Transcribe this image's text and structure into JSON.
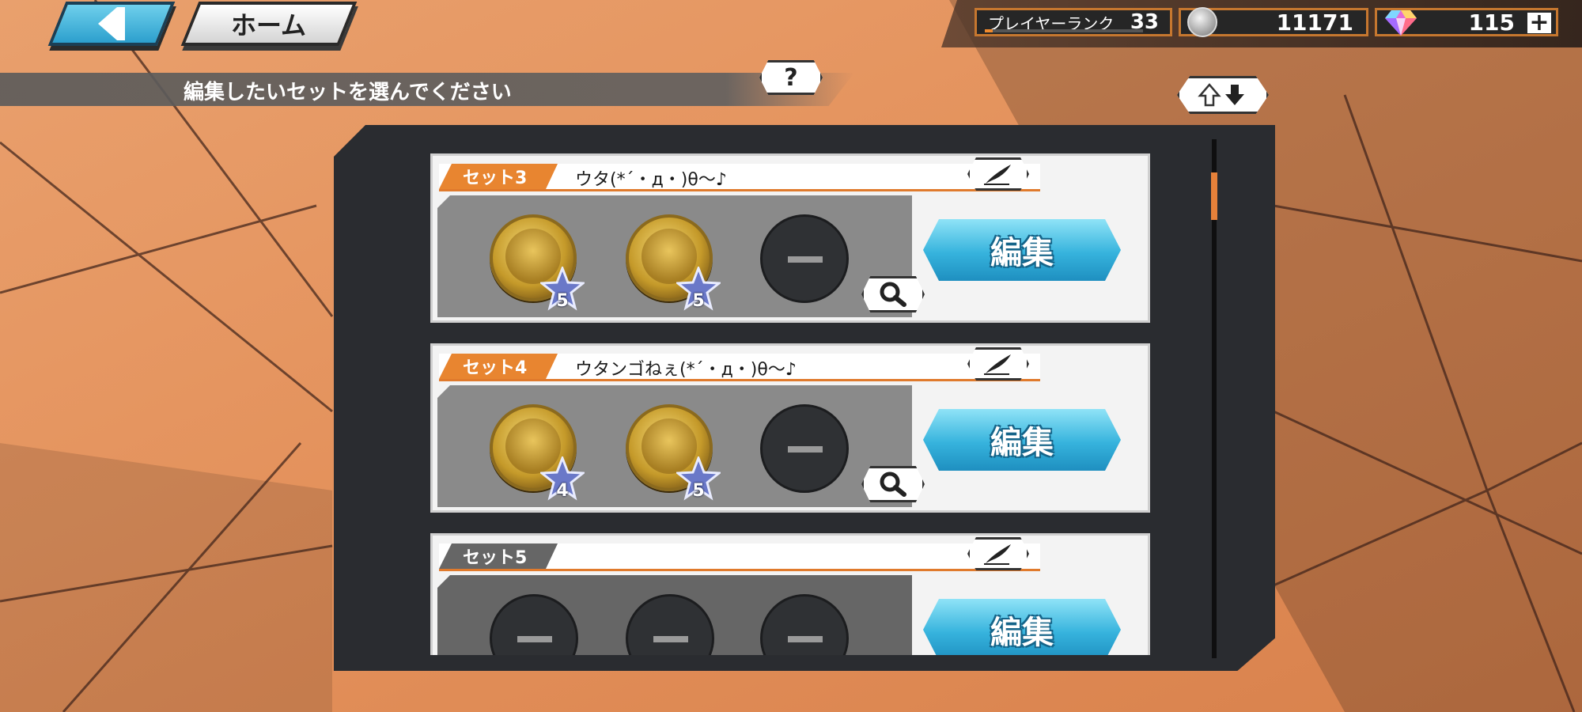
{
  "nav": {
    "home_label": "ホーム"
  },
  "status": {
    "player_rank_label": "プレイヤーランク",
    "player_rank": "33",
    "rank_progress": 0.05,
    "berries": "11171",
    "gems": "115"
  },
  "instruction": "編集したいセットを選んでください",
  "help_label": "?",
  "sets": [
    {
      "tag": "セット3",
      "name": "ウタ(*´・д・)θ〜♪",
      "edit_label": "編集",
      "slots": [
        {
          "filled": true,
          "stars": "5"
        },
        {
          "filled": true,
          "stars": "5"
        },
        {
          "filled": false
        }
      ]
    },
    {
      "tag": "セット4",
      "name": "ウタンゴねぇ(*´・д・)θ〜♪",
      "edit_label": "編集",
      "slots": [
        {
          "filled": true,
          "stars": "4"
        },
        {
          "filled": true,
          "stars": "5"
        },
        {
          "filled": false
        }
      ]
    },
    {
      "tag": "セット5",
      "name": "",
      "edit_label": "編集",
      "slots": [
        {
          "filled": false
        },
        {
          "filled": false
        },
        {
          "filled": false
        }
      ]
    }
  ],
  "colors": {
    "accent_orange": "#e88530",
    "edit_blue": "#36b3dd",
    "panel": "#2a2c30",
    "background_orange": "#e5935f"
  },
  "icons": {
    "back": "back-arrow-icon",
    "help": "question-icon",
    "sort": "sort-arrows-icon",
    "rename": "quill-pen-icon",
    "zoom": "magnifier-icon",
    "currency": "berry-coin-icon",
    "gem": "rainbow-gem-icon",
    "add": "plus-icon"
  }
}
